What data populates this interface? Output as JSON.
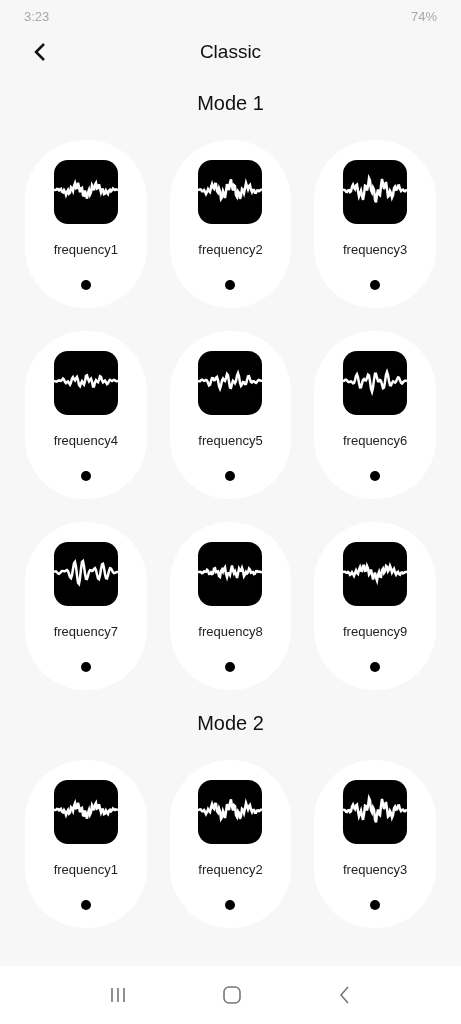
{
  "status_bar": {
    "time": "3:23",
    "battery": "74%"
  },
  "header": {
    "title": "Classic"
  },
  "sections": [
    {
      "title": "Mode 1",
      "items": [
        {
          "label": "frequency1"
        },
        {
          "label": "frequency2"
        },
        {
          "label": "frequency3"
        },
        {
          "label": "frequency4"
        },
        {
          "label": "frequency5"
        },
        {
          "label": "frequency6"
        },
        {
          "label": "frequency7"
        },
        {
          "label": "frequency8"
        },
        {
          "label": "frequency9"
        }
      ]
    },
    {
      "title": "Mode 2",
      "items": [
        {
          "label": "frequency1"
        },
        {
          "label": "frequency2"
        },
        {
          "label": "frequency3"
        }
      ]
    }
  ]
}
